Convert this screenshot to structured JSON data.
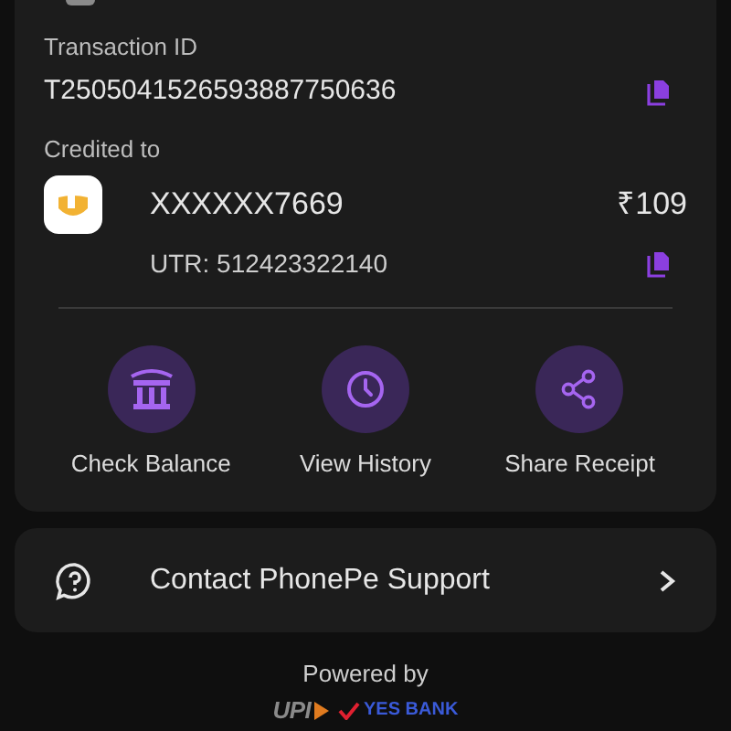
{
  "transaction": {
    "label": "Transaction ID",
    "value": "T2505041526593887750636"
  },
  "credited": {
    "label": "Credited to",
    "account": "XXXXXX7669",
    "amount": "₹109",
    "utr": "UTR: 512423322140"
  },
  "actions": [
    {
      "kind": "bank",
      "label": "Check Balance"
    },
    {
      "kind": "history",
      "label": "View History"
    },
    {
      "kind": "share",
      "label": "Share Receipt"
    }
  ],
  "support": {
    "label": "Contact PhonePe Support"
  },
  "footer": {
    "powered_by": "Powered by",
    "upi": "UPI",
    "bank": "YES BANK"
  }
}
